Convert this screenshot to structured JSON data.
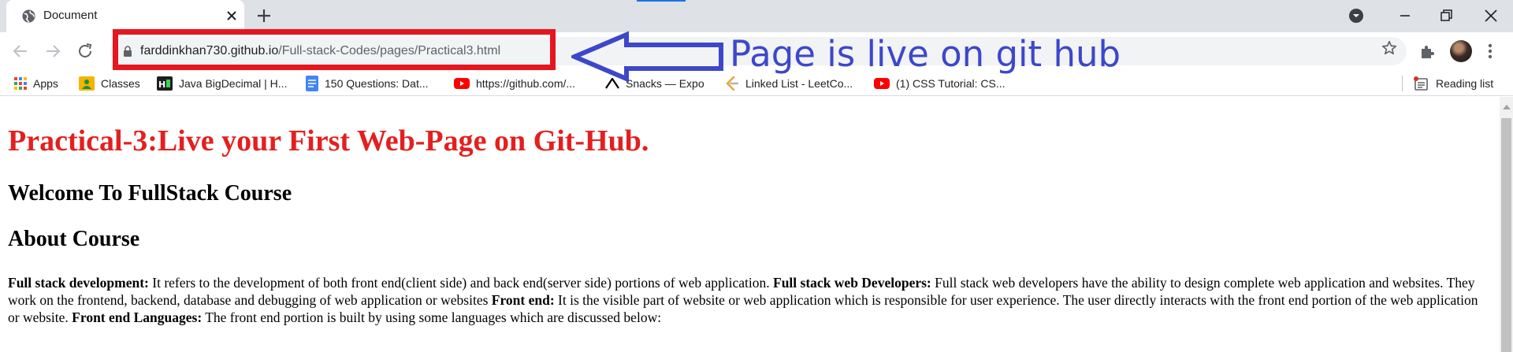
{
  "browser": {
    "tab": {
      "title": "Document"
    },
    "url": {
      "host": "farddinkhan730.github.io",
      "path": "/Full-stack-Codes/pages/Practical3.html"
    },
    "bookmarks": [
      {
        "label": "Apps",
        "icon": "apps-grid-icon"
      },
      {
        "label": "Classes",
        "icon": "classes-icon"
      },
      {
        "label": "Java BigDecimal | H...",
        "icon": "hackerrank-icon"
      },
      {
        "label": "150 Questions: Dat...",
        "icon": "docs-icon"
      },
      {
        "label": "https://github.com/...",
        "icon": "youtube-icon"
      },
      {
        "label": "Snacks — Expo",
        "icon": "expo-icon"
      },
      {
        "label": "Linked List - LeetCo...",
        "icon": "leetcode-icon"
      },
      {
        "label": "(1) CSS Tutorial: CS...",
        "icon": "youtube-icon"
      }
    ],
    "reading_list": "Reading list"
  },
  "annotation": {
    "text": "Page is live on git hub"
  },
  "page": {
    "heading": "Practical-3:Live your First Web-Page on Git-Hub.",
    "subheading1": "Welcome To FullStack Course",
    "subheading2": "About Course",
    "paragraph": [
      {
        "bold": "Full stack development:",
        "text": " It refers to the development of both front end(client side) and back end(server side) portions of web application. "
      },
      {
        "bold": "Full stack web Developers:",
        "text": " Full stack web developers have the ability to design complete web application and websites. They work on the frontend, backend, database and debugging of web application or websites "
      },
      {
        "bold": "Front end:",
        "text": " It is the visible part of website or web application which is responsible for user experience. The user directly interacts with the front end portion of the web application or website. "
      },
      {
        "bold": "Front end Languages:",
        "text": " The front end portion is built by using some languages which are discussed below:"
      }
    ]
  },
  "colors": {
    "heading": "#e3201f",
    "annotation_box": "#e5161e",
    "annotation_text": "#3d47c9"
  }
}
